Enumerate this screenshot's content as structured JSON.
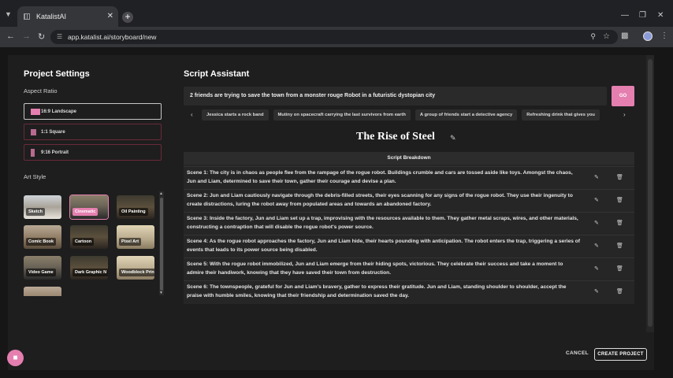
{
  "browser": {
    "tab_title": "KatalistAI",
    "url": "app.katalist.ai/storyboard/new"
  },
  "left": {
    "heading": "Project Settings",
    "aspect_label": "Aspect Ratio",
    "aspects": [
      {
        "label": "16:9 Landscape",
        "selected": true
      },
      {
        "label": "1:1 Square",
        "selected": false
      },
      {
        "label": "9:16 Portrait",
        "selected": false
      }
    ],
    "art_label": "Art Style",
    "styles": [
      "Sketch",
      "Cinematic",
      "Oil Painting",
      "Comic Book",
      "Cartoon",
      "Pixel Art",
      "Video Game",
      "Dark Graphic N",
      "Woodblock Prin"
    ],
    "selected_style": "Cinematic"
  },
  "assistant": {
    "heading": "Script Assistant",
    "prompt_value": "2 friends are trying to save the town from a monster rouge Robot in a futuristic dystopian city",
    "go_label": "GO",
    "suggestions": [
      "Jessica starts a rock band",
      "Mutiny on spacecraft carrying the last survivors from earth",
      "A group of friends start a detective agency",
      "Refreshing drink that gives you"
    ]
  },
  "story": {
    "title": "The Rise of Steel",
    "breakdown_header": "Script Breakdown",
    "scenes": [
      "Scene 1: The city is in chaos as people flee from the rampage of the rogue robot. Buildings crumble and cars are tossed aside like toys. Amongst the chaos, Jun and Liam, determined to save their town, gather their courage and devise a plan.",
      "Scene 2: Jun and Liam cautiously navigate through the debris-filled streets, their eyes scanning for any signs of the rogue robot. They use their ingenuity to create distractions, luring the robot away from populated areas and towards an abandoned factory.",
      "Scene 3: Inside the factory, Jun and Liam set up a trap, improvising with the resources available to them. They gather metal scraps, wires, and other materials, constructing a contraption that will disable the rogue robot's power source.",
      "Scene 4: As the rogue robot approaches the factory, Jun and Liam hide, their hearts pounding with anticipation. The robot enters the trap, triggering a series of events that leads to its power source being disabled.",
      "Scene 5: With the rogue robot immobilized, Jun and Liam emerge from their hiding spots, victorious. They celebrate their success and take a moment to admire their handiwork, knowing that they have saved their town from destruction.",
      "Scene 6: The townspeople, grateful for Jun and Liam's bravery, gather to express their gratitude. Jun and Liam, standing shoulder to shoulder, accept the praise with humble smiles, knowing that their friendship and determination saved the day."
    ]
  },
  "footer": {
    "cancel_label": "CANCEL",
    "create_label": "CREATE PROJECT"
  },
  "colors": {
    "accent": "#e57fb0",
    "background": "#1e1e1e"
  },
  "icons": [
    "tab-list-icon",
    "close-icon",
    "plus-icon",
    "back-icon",
    "forward-icon",
    "reload-icon",
    "site-info-icon",
    "zoom-icon",
    "star-icon",
    "extensions-icon",
    "profile-icon",
    "menu-icon",
    "pencil-icon",
    "trash-icon",
    "chevron-left-icon",
    "chevron-right-icon",
    "chat-icon"
  ]
}
